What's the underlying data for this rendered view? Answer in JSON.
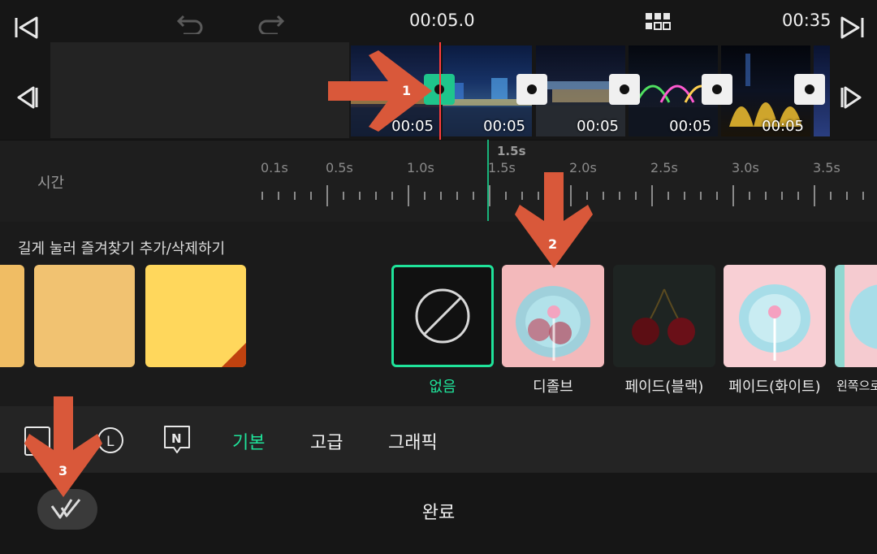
{
  "topbar": {
    "current_time": "00:05.0",
    "total_time": "00:35",
    "icons": [
      "skip-to-start-icon",
      "undo-icon",
      "redo-icon",
      "grid-view-icon",
      "skip-to-end-icon"
    ]
  },
  "clips": [
    {
      "duration": "00:05"
    },
    {
      "duration": "00:05"
    },
    {
      "duration": "00:05"
    },
    {
      "duration": "00:05"
    },
    {
      "duration": "00:05"
    }
  ],
  "timeline": {
    "row_label": "시간",
    "cursor_value": "1.5s",
    "ticks": [
      "0.1s",
      "0.5s",
      "1.0s",
      "1.5s",
      "2.0s",
      "2.5s",
      "3.0s",
      "3.5s"
    ]
  },
  "favorites": {
    "hint": "길게 눌러 즐겨찾기 추가/삭제하기"
  },
  "effects": [
    {
      "label": "없음",
      "selected": true
    },
    {
      "label": "디졸브"
    },
    {
      "label": "페이드(블랙)"
    },
    {
      "label": "페이드(화이트)"
    },
    {
      "label": "왼쪽으로"
    }
  ],
  "tabs": [
    {
      "label": "기본",
      "active": true
    },
    {
      "label": "고급"
    },
    {
      "label": "그래픽"
    }
  ],
  "bottom": {
    "done_label": "완료"
  },
  "annotations": [
    "1",
    "2",
    "3"
  ],
  "colors": {
    "accent": "#1fe39a",
    "playhead": "#ff3b3b",
    "annotation_arrow": "#d9583a"
  }
}
